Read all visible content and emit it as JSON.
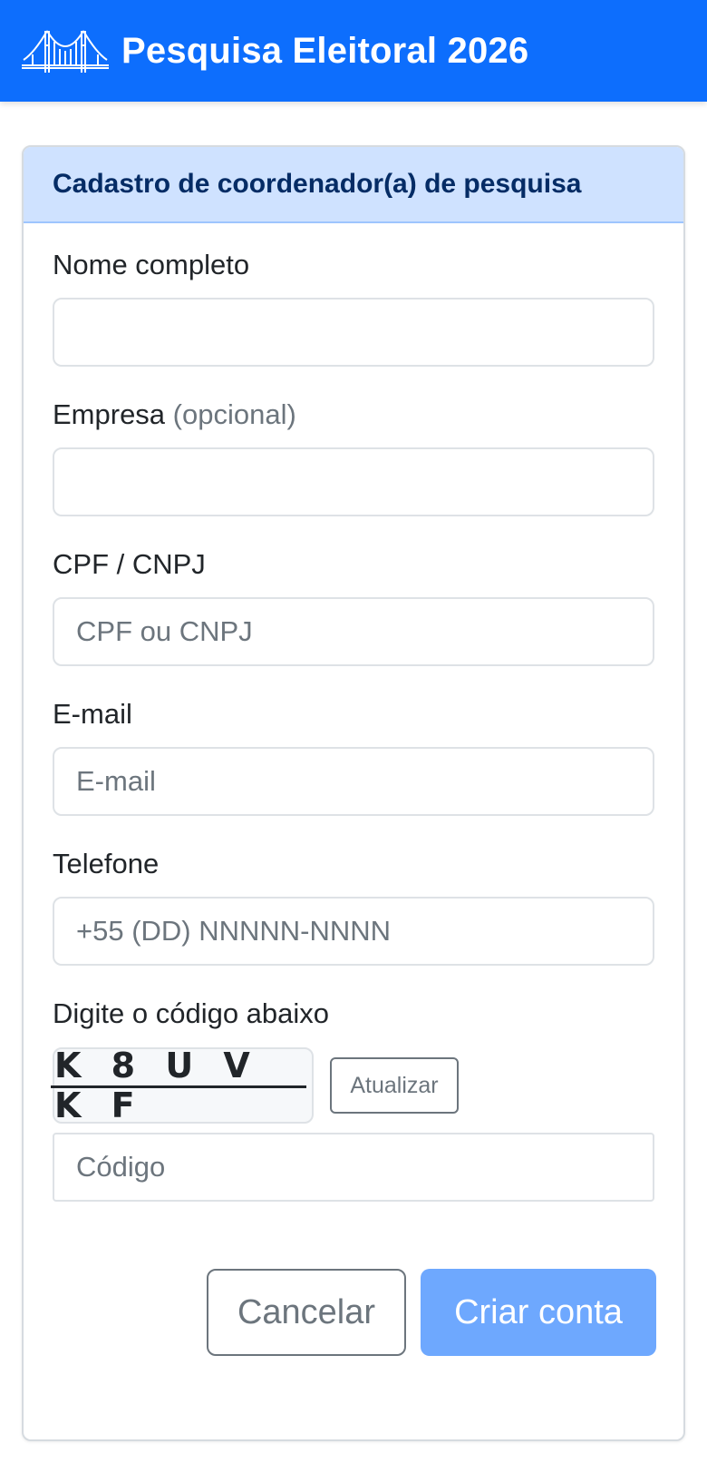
{
  "navbar": {
    "logo_icon": "bridge-icon",
    "title": "Pesquisa Eleitoral 2026"
  },
  "card": {
    "title": "Cadastro de coordenador(a) de pesquisa"
  },
  "form": {
    "nome": {
      "label": "Nome completo",
      "value": "",
      "placeholder": ""
    },
    "empresa": {
      "label": "Empresa",
      "hint": "(opcional)",
      "value": "",
      "placeholder": ""
    },
    "documento": {
      "label": "CPF / CNPJ",
      "placeholder": "CPF ou CNPJ"
    },
    "email": {
      "label": "E-mail",
      "placeholder": "E-mail"
    },
    "telefone": {
      "label": "Telefone",
      "placeholder": "+55 (DD) NNNNN-NNNN"
    },
    "captcha": {
      "label": "Digite o código abaixo",
      "code": "K 8 U V K F",
      "refresh_label": "Atualizar",
      "input_placeholder": "Código"
    }
  },
  "actions": {
    "cancel_label": "Cancelar",
    "submit_label": "Criar conta"
  },
  "colors": {
    "primary": "#0d6efd",
    "header_bg": "#cfe2ff",
    "submit_disabled": "#6ea8fe"
  }
}
